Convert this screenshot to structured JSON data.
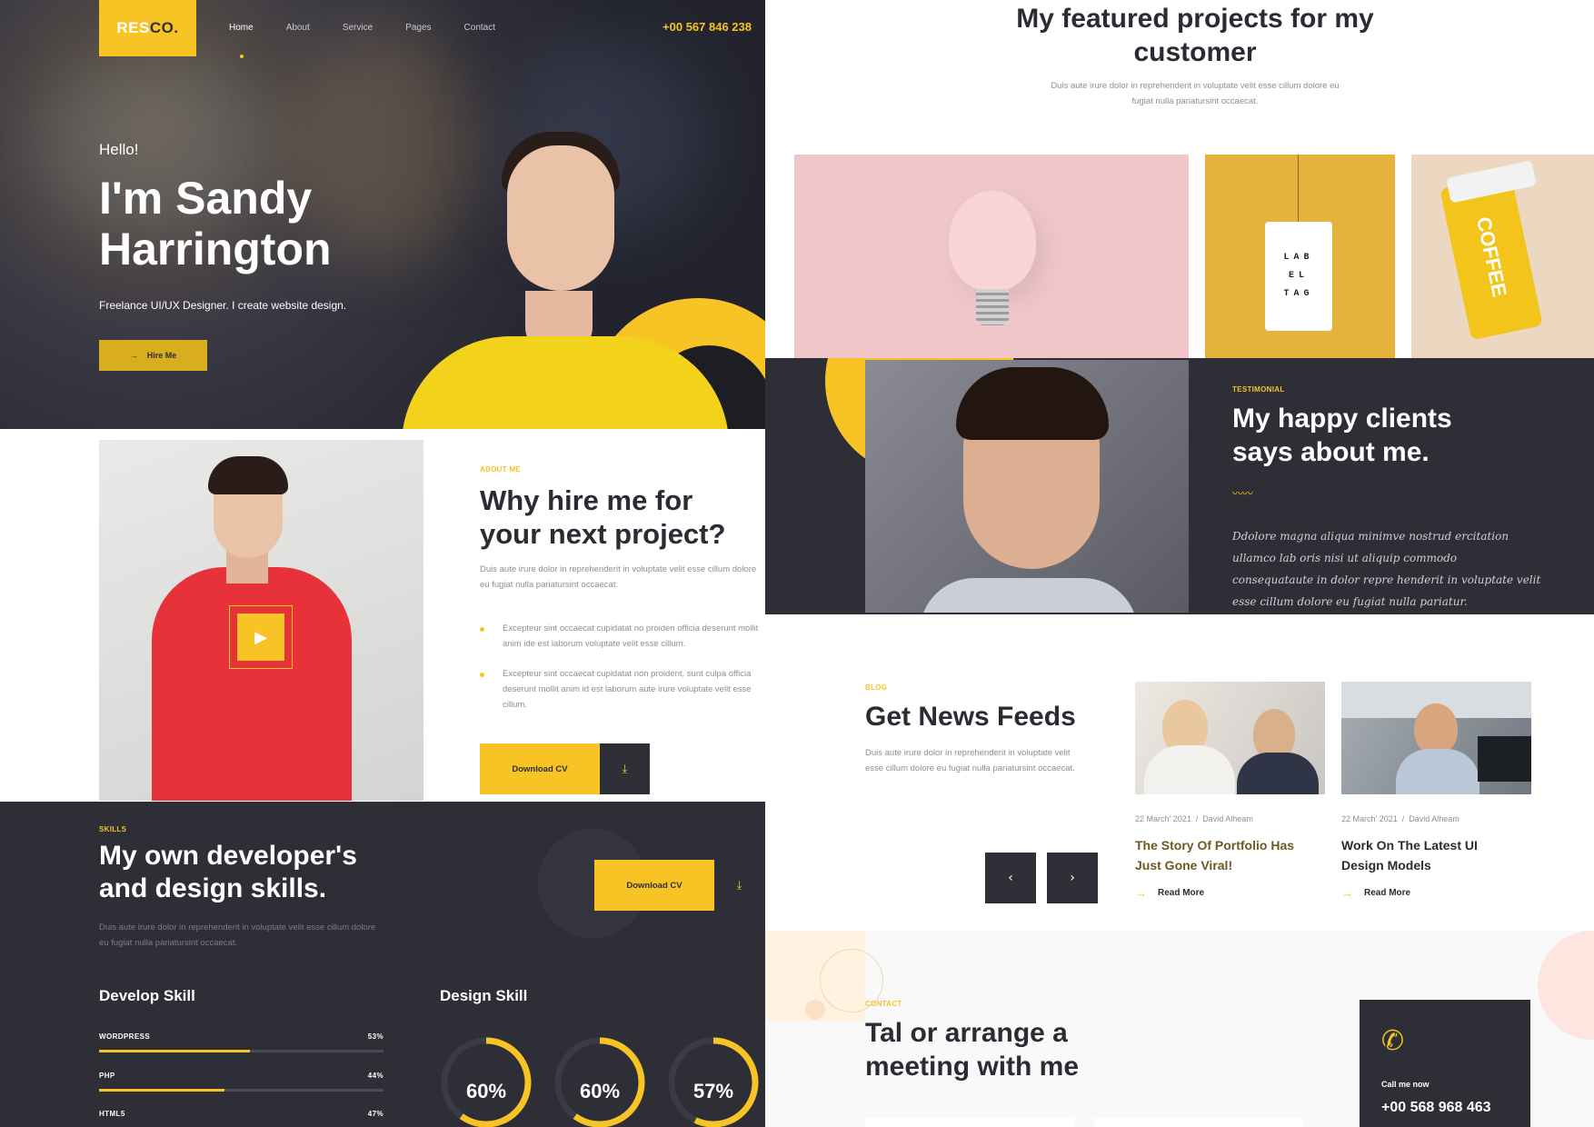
{
  "colors": {
    "accent": "#f7c325",
    "dark": "#2e2f36",
    "text": "#2b2b33",
    "muted": "#8d8d95"
  },
  "header": {
    "logo_res": "RES",
    "logo_co": "CO.",
    "nav": [
      "Home",
      "About",
      "Service",
      "Pages",
      "Contact"
    ],
    "phone": "+00 567 846 238"
  },
  "hero": {
    "greeting": "Hello!",
    "name": "I'm Sandy Harrington",
    "subtitle": "Freelance UI/UX Designer. I create website design.",
    "cta": "Hire Me"
  },
  "about": {
    "tag": "ABOUT ME",
    "title": "Why hire me for your next project?",
    "intro": "Duis aute irure dolor in reprehenderit in voluptate velit esse cillum dolore eu fugiat nulla pariatursint occaecat.",
    "bullets": [
      "Excepteur sint occaecat cupidatat no proiden officia deserunt mollit anim ide est laborum voluptate velit esse cillum.",
      "Excepteur sint occaecat cupidatat non proident, sunt culpa officia deserunt mollit anim id est laborum aute irure voluptate velit esse cillum."
    ],
    "download": "Download CV"
  },
  "skills": {
    "tag": "SKILLS",
    "title": "My own developer's and design skills.",
    "intro": "Duis aute irure dolor in reprehenderit in voluptate velit esse cillum dolore eu fugiat nulla pariatursint occaecat.",
    "download": "Download CV",
    "develop_title": "Develop Skill",
    "design_title": "Design Skill",
    "develop": [
      {
        "name": "WORDPRESS",
        "label": "53%",
        "value": 53
      },
      {
        "name": "PHP",
        "label": "44%",
        "value": 44
      },
      {
        "name": "HTML5",
        "label": "47%",
        "value": 47
      }
    ],
    "design": [
      {
        "label": "60%",
        "value": 60
      },
      {
        "label": "60%",
        "value": 60
      },
      {
        "label": "57%",
        "value": 57
      }
    ]
  },
  "projects": {
    "title": "My featured projects for my customer",
    "intro": "Duis aute irure dolor in reprehenderit in voluptate velit esse cillum dolore eu fugiat nulla pariatursint occaecat.",
    "tag_card": [
      "LAB",
      "EL",
      "TAG"
    ],
    "cup_text": "COFFEE"
  },
  "testimonial": {
    "tag": "TESTIMONIAL",
    "title": "My happy clients says about me.",
    "quote": "Ddolore magna aliqua minimve nostrud ercitation ullamco lab oris nisi ut aliquip commodo consequataute in dolor repre henderit in voluptate velit esse cillum dolore eu fugiat nulla pariatur."
  },
  "blog": {
    "tag": "BLOG",
    "title": "Get News Feeds",
    "intro": "Duis aute irure dolor in reprehenderit in voluptate velit esse cillum dolore eu fugiat nulla pariatursint occaecat.",
    "prev": "‹",
    "next": "›",
    "posts": [
      {
        "date": "22 March' 2021",
        "author": "David Alheam",
        "title": "The Story Of Portfolio Has Just Gone Viral!",
        "read": "Read More"
      },
      {
        "date": "22 March' 2021",
        "author": "David Alheam",
        "title": "Work On The Latest UI Design Models",
        "read": "Read More"
      }
    ]
  },
  "contact": {
    "tag": "CONTACT",
    "title": "Tal or arrange a meeting with me",
    "call_label": "Call me now",
    "call_number": "+00 568 968 463"
  }
}
